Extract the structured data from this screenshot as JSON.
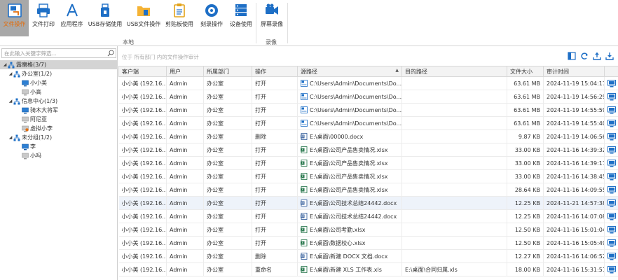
{
  "ribbon": {
    "buttons": [
      {
        "label": "文件操作",
        "icon": "file-operation-icon",
        "active": true
      },
      {
        "label": "文件打印",
        "icon": "printer-icon"
      },
      {
        "label": "应用程序",
        "icon": "app-store-icon"
      },
      {
        "label": "USB存储使用",
        "icon": "usb-storage-icon"
      },
      {
        "label": "USB文件操作",
        "icon": "usb-file-icon"
      },
      {
        "label": "剪贴板使用",
        "icon": "clipboard-icon"
      },
      {
        "label": "刻录操作",
        "icon": "disc-burn-icon"
      },
      {
        "label": "设备使用",
        "icon": "device-icon"
      },
      {
        "label": "屏幕录像",
        "icon": "screen-record-icon"
      }
    ],
    "groups": [
      "本地",
      "录像"
    ]
  },
  "left": {
    "search_placeholder": "在此输入关键字筛选...",
    "tree": [
      {
        "label": "露磨格(3/7)",
        "level": 0,
        "type": "org",
        "expanded": true
      },
      {
        "label": "办公室(1/2)",
        "level": 1,
        "type": "org",
        "expanded": true
      },
      {
        "label": "小小美",
        "level": 2,
        "type": "pc-online"
      },
      {
        "label": "小高",
        "level": 2,
        "type": "pc-offline"
      },
      {
        "label": "信息中心(1/3)",
        "level": 1,
        "type": "org",
        "expanded": true
      },
      {
        "label": "骑木大将军",
        "level": 2,
        "type": "pc-online"
      },
      {
        "label": "阿尼亚",
        "level": 2,
        "type": "pc-offline"
      },
      {
        "label": "虚拟小李",
        "level": 2,
        "type": "pc-virtual"
      },
      {
        "label": "未分组(1/2)",
        "level": 1,
        "type": "org",
        "expanded": true
      },
      {
        "label": "李",
        "level": 2,
        "type": "pc-online"
      },
      {
        "label": "小吗",
        "level": 2,
        "type": "pc-offline"
      }
    ]
  },
  "main": {
    "hint": "位于 所有部门 内的文件操作审计",
    "columns": [
      "客户端",
      "用户",
      "所属部门",
      "操作",
      "源路径",
      "目的路径",
      "文件大小",
      "审计时间"
    ],
    "rows": [
      {
        "client": "小小美 (192.16...",
        "user": "Admin",
        "dept": "办公室",
        "op": "打开",
        "icon": "folder",
        "src": "C:\\Users\\Admin\\Documents\\Do...",
        "dst": "",
        "size": "63.61 MB",
        "time": "2024-11-19 15:04:17"
      },
      {
        "client": "小小美 (192.16...",
        "user": "Admin",
        "dept": "办公室",
        "op": "打开",
        "icon": "folder",
        "src": "C:\\Users\\Admin\\Documents\\Do...",
        "dst": "",
        "size": "63.61 MB",
        "time": "2024-11-19 14:56:29"
      },
      {
        "client": "小小美 (192.16...",
        "user": "Admin",
        "dept": "办公室",
        "op": "打开",
        "icon": "folder",
        "src": "C:\\Users\\Admin\\Documents\\Do...",
        "dst": "",
        "size": "63.61 MB",
        "time": "2024-11-19 14:55:59"
      },
      {
        "client": "小小美 (192.16...",
        "user": "Admin",
        "dept": "办公室",
        "op": "打开",
        "icon": "folder",
        "src": "C:\\Users\\Admin\\Documents\\Do...",
        "dst": "",
        "size": "63.61 MB",
        "time": "2024-11-19 14:55:40"
      },
      {
        "client": "小小美 (192.16...",
        "user": "Admin",
        "dept": "办公室",
        "op": "删除",
        "icon": "word",
        "src": "E:\\桌面\\00000.docx",
        "dst": "",
        "size": "9.87 KB",
        "time": "2024-11-19 14:06:56"
      },
      {
        "client": "小小美 (192.16...",
        "user": "Admin",
        "dept": "办公室",
        "op": "打开",
        "icon": "excel",
        "src": "E:\\桌面\\公司产品售卖情况.xlsx",
        "dst": "",
        "size": "33.00 KB",
        "time": "2024-11-16 14:39:32"
      },
      {
        "client": "小小美 (192.16...",
        "user": "Admin",
        "dept": "办公室",
        "op": "打开",
        "icon": "excel",
        "src": "E:\\桌面\\公司产品售卖情况.xlsx",
        "dst": "",
        "size": "33.00 KB",
        "time": "2024-11-16 14:39:17"
      },
      {
        "client": "小小美 (192.16...",
        "user": "Admin",
        "dept": "办公室",
        "op": "打开",
        "icon": "excel",
        "src": "E:\\桌面\\公司产品售卖情况.xlsx",
        "dst": "",
        "size": "33.00 KB",
        "time": "2024-11-16 14:38:45"
      },
      {
        "client": "小小美 (192.16...",
        "user": "Admin",
        "dept": "办公室",
        "op": "打开",
        "icon": "excel",
        "src": "E:\\桌面\\公司产品售卖情况.xlsx",
        "dst": "",
        "size": "28.64 KB",
        "time": "2024-11-16 14:09:55"
      },
      {
        "client": "小小美 (192.16...",
        "user": "Admin",
        "dept": "办公室",
        "op": "打开",
        "icon": "word",
        "src": "E:\\桌面\\公司技术总结24442.docx",
        "dst": "",
        "size": "12.25 KB",
        "time": "2024-11-21 14:57:38",
        "highlight": true
      },
      {
        "client": "小小美 (192.16...",
        "user": "Admin",
        "dept": "办公室",
        "op": "打开",
        "icon": "word",
        "src": "E:\\桌面\\公司技术总结24442.docx",
        "dst": "",
        "size": "12.25 KB",
        "time": "2024-11-16 14:07:08"
      },
      {
        "client": "小小美 (192.16...",
        "user": "Admin",
        "dept": "办公室",
        "op": "打开",
        "icon": "excel",
        "src": "E:\\桌面\\公司考勤.xlsx",
        "dst": "",
        "size": "12.50 KB",
        "time": "2024-11-16 15:01:04"
      },
      {
        "client": "小小美 (192.16...",
        "user": "Admin",
        "dept": "办公室",
        "op": "打开",
        "icon": "excel",
        "src": "E:\\桌面\\数据校心.xlsx",
        "dst": "",
        "size": "12.50 KB",
        "time": "2024-11-16 15:05:49"
      },
      {
        "client": "小小美 (192.16...",
        "user": "Admin",
        "dept": "办公室",
        "op": "删除",
        "icon": "word",
        "src": "E:\\桌面\\新建 DOCX 文档.docx",
        "dst": "",
        "size": "12.27 KB",
        "time": "2024-11-16 14:06:52"
      },
      {
        "client": "小小美 (192.16...",
        "user": "Admin",
        "dept": "办公室",
        "op": "重命名",
        "icon": "excel",
        "src": "E:\\桌面\\新建 XLS 工作表.xls",
        "dst": "E:\\桌面\\合同归属.xls",
        "size": "18.00 KB",
        "time": "2024-11-16 15:31:51"
      }
    ]
  }
}
